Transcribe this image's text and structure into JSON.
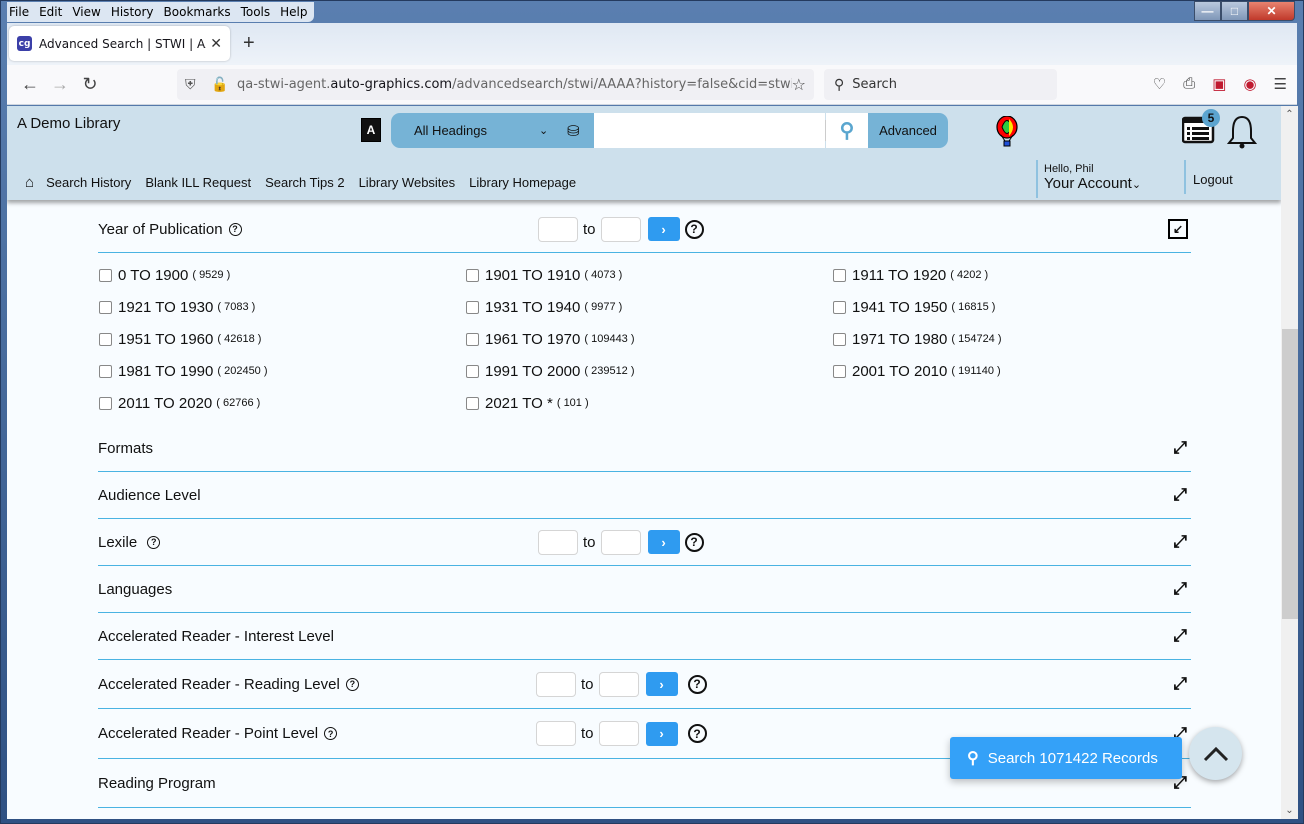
{
  "browser": {
    "menu": [
      "File",
      "Edit",
      "View",
      "History",
      "Bookmarks",
      "Tools",
      "Help"
    ],
    "tab_title": "Advanced Search | STWI | AAAA",
    "favicon_text": "cg",
    "url_host_prefix": "qa-stwi-agent.",
    "url_host_domain": "auto-graphics.com",
    "url_path": "/advancedsearch/stwi/AAAA?history=false&cid=stwi&lid",
    "search_placeholder": "Search"
  },
  "header": {
    "library_name": "A Demo Library",
    "search_scope": "All Headings",
    "search_value": "",
    "advanced_label": "Advanced",
    "notification_count": "5",
    "nav_links": [
      "Search History",
      "Blank ILL Request",
      "Search Tips 2",
      "Library Websites",
      "Library Homepage"
    ],
    "greeting": "Hello, Phil",
    "account_label": "Your Account",
    "logout_label": "Logout"
  },
  "facets": {
    "year_of_publication": {
      "title": "Year of Publication",
      "to_label": "to",
      "options": [
        {
          "label": "0 TO 1900",
          "count": "( 9529 )"
        },
        {
          "label": "1901 TO 1910",
          "count": "( 4073 )"
        },
        {
          "label": "1911 TO 1920",
          "count": "( 4202 )"
        },
        {
          "label": "1921 TO 1930",
          "count": "( 7083 )"
        },
        {
          "label": "1931 TO 1940",
          "count": "( 9977 )"
        },
        {
          "label": "1941 TO 1950",
          "count": "( 16815 )"
        },
        {
          "label": "1951 TO 1960",
          "count": "( 42618 )"
        },
        {
          "label": "1961 TO 1970",
          "count": "( 109443 )"
        },
        {
          "label": "1971 TO 1980",
          "count": "( 154724 )"
        },
        {
          "label": "1981 TO 1990",
          "count": "( 202450 )"
        },
        {
          "label": "1991 TO 2000",
          "count": "( 239512 )"
        },
        {
          "label": "2001 TO 2010",
          "count": "( 191140 )"
        },
        {
          "label": "2011 TO 2020",
          "count": "( 62766 )"
        },
        {
          "label": "2021 TO *",
          "count": "( 101 )"
        }
      ]
    },
    "formats": {
      "title": "Formats"
    },
    "audience_level": {
      "title": "Audience Level"
    },
    "lexile": {
      "title": "Lexile",
      "to_label": "to"
    },
    "languages": {
      "title": "Languages"
    },
    "ar_interest": {
      "title": "Accelerated Reader - Interest Level"
    },
    "ar_reading": {
      "title": "Accelerated Reader - Reading Level",
      "to_label": "to"
    },
    "ar_point": {
      "title": "Accelerated Reader - Point Level",
      "to_label": "to"
    },
    "reading_program": {
      "title": "Reading Program"
    }
  },
  "float_search_label": "Search 1071422 Records"
}
